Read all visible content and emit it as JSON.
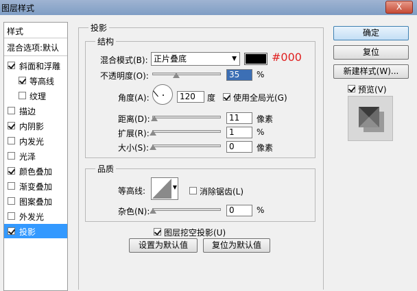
{
  "window": {
    "title": "图层样式",
    "close_label": "X"
  },
  "sidebar": {
    "header": "样式",
    "blend_label": "混合选项:默认",
    "items": [
      {
        "label": "斜面和浮雕",
        "checked": true
      },
      {
        "label": "等高线",
        "checked": true
      },
      {
        "label": "纹理",
        "checked": false
      },
      {
        "label": "描边",
        "checked": false
      },
      {
        "label": "内阴影",
        "checked": true
      },
      {
        "label": "内发光",
        "checked": false
      },
      {
        "label": "光泽",
        "checked": false
      },
      {
        "label": "颜色叠加",
        "checked": true
      },
      {
        "label": "渐变叠加",
        "checked": false
      },
      {
        "label": "图案叠加",
        "checked": false
      },
      {
        "label": "外发光",
        "checked": false
      },
      {
        "label": "投影",
        "checked": true,
        "active": true
      }
    ]
  },
  "shadow": {
    "title": "投影",
    "structure": {
      "title": "结构",
      "blend_mode_label": "混合模式(B):",
      "blend_mode_value": "正片叠底",
      "color_hex": "#000",
      "opacity_label": "不透明度(O):",
      "opacity_value": "35",
      "opacity_unit": "%",
      "opacity_level": 0.35,
      "angle_label": "角度(A):",
      "angle_value": "120",
      "angle_unit": "度",
      "global_light_label": "使用全局光(G)",
      "global_light_checked": true,
      "distance_label": "距离(D):",
      "distance_value": "11",
      "distance_unit": "像素",
      "spread_label": "扩展(R):",
      "spread_value": "1",
      "spread_unit": "%",
      "size_label": "大小(S):",
      "size_value": "0",
      "size_unit": "像素"
    },
    "quality": {
      "title": "品质",
      "contour_label": "等高线:",
      "antialias_label": "消除锯齿(L)",
      "antialias_checked": false,
      "noise_label": "杂色(N):",
      "noise_value": "0",
      "noise_unit": "%"
    },
    "knockout_label": "图层挖空投影(U)",
    "knockout_checked": true,
    "set_default_label": "设置为默认值",
    "reset_default_label": "复位为默认值"
  },
  "buttons": {
    "ok": "确定",
    "reset": "复位",
    "new_style": "新建样式(W)...",
    "preview_label": "预览(V)",
    "preview_checked": true
  },
  "colors": {
    "accent_red": "#e02020",
    "selected_blue": "#3399ff",
    "swatch": "#000000"
  }
}
